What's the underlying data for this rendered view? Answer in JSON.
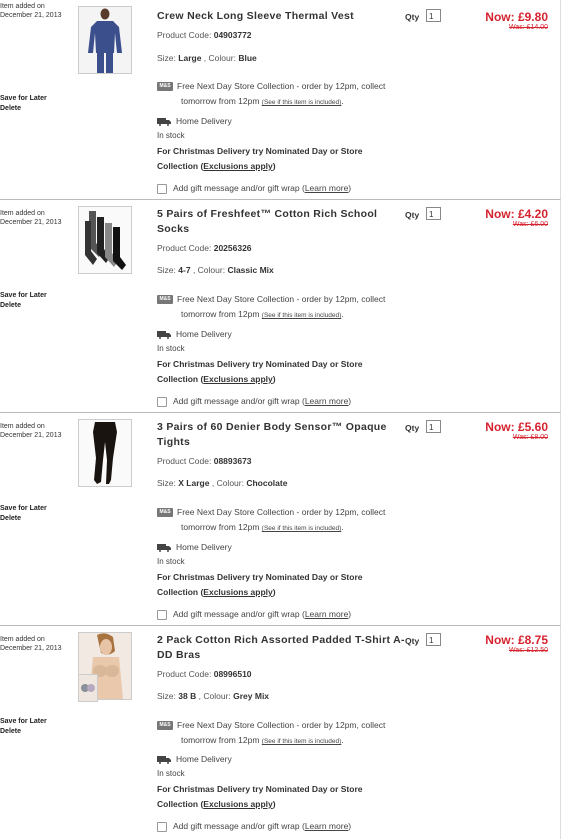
{
  "labels": {
    "added_line1": "Item added on",
    "save_for_later": "Save for Later",
    "delete": "Delete",
    "product_code_label": "Product Code:",
    "size_label": "Size:",
    "colour_label": "Colour:",
    "qty_label": "Qty",
    "store_icon_text": "M&S",
    "store_line1": "Free Next Day Store Collection - order by 12pm, collect",
    "store_line2": "tomorrow from 12pm",
    "store_link": "(See if this item is included)",
    "home_delivery": "Home Delivery",
    "in_stock": "In stock",
    "xmas_line1": "For Christmas Delivery try Nominated Day or Store",
    "xmas_collection": "Collection",
    "xmas_link": "Exclusions apply",
    "gift_text": "Add gift message and/or gift wrap",
    "learn_more": "Learn more"
  },
  "items": [
    {
      "added_date": "December 21, 2013",
      "title": "Crew Neck Long Sleeve Thermal Vest",
      "product_code": "04903772",
      "size": "Large",
      "colour": "Blue",
      "qty": "1",
      "now_price": "Now: £9.80",
      "was_price": "Was: £14.00"
    },
    {
      "added_date": "December 21, 2013",
      "title": "5 Pairs of Freshfeet™ Cotton Rich School Socks",
      "product_code": "20256326",
      "size": "4-7",
      "colour": "Classic Mix",
      "qty": "1",
      "now_price": "Now: £4.20",
      "was_price": "Was: £6.00"
    },
    {
      "added_date": "December 21, 2013",
      "title": "3 Pairs of 60 Denier Body Sensor™ Opaque Tights",
      "product_code": "08893673",
      "size": "X Large",
      "colour": "Chocolate",
      "qty": "1",
      "now_price": "Now: £5.60",
      "was_price": "Was: £8.00"
    },
    {
      "added_date": "December 21, 2013",
      "title": "2 Pack Cotton Rich Assorted Padded T-Shirt A-DD Bras",
      "product_code": "08996510",
      "size": "38 B",
      "colour": "Grey Mix",
      "qty": "1",
      "now_price": "Now: £8.75",
      "was_price": "Was: £12.50"
    }
  ]
}
